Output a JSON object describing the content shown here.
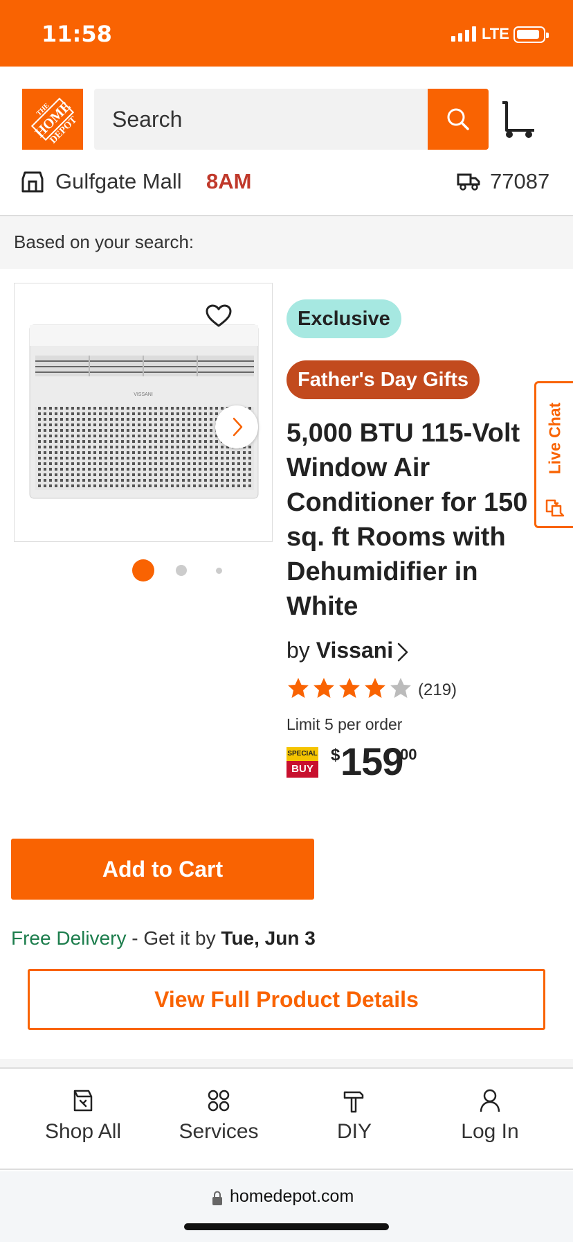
{
  "status_bar": {
    "time": "11:58",
    "network": "LTE"
  },
  "header": {
    "search": {
      "placeholder": "Search"
    },
    "store": {
      "name": "Gulfgate Mall",
      "hours": "8AM"
    },
    "zip": "77087"
  },
  "based_on": "Based on your search:",
  "product": {
    "badges": {
      "exclusive": "Exclusive",
      "promo": "Father's Day Gifts"
    },
    "title": "5,000 BTU 115-Volt Window Air Conditioner for 150 sq. ft Rooms with Dehumidifier in White",
    "brand_prefix": "by",
    "brand": "Vissani",
    "rating": 4,
    "rating_max": 5,
    "review_count": "(219)",
    "limit": "Limit 5 per order",
    "special_buy": {
      "top": "SPECIAL",
      "bottom": "BUY"
    },
    "price": {
      "currency": "$",
      "dollars": "159",
      "cents": "00"
    },
    "image_count": 3,
    "image_active": 1,
    "image_brand_text": "VISSANI"
  },
  "actions": {
    "add_to_cart": "Add to Cart",
    "delivery_free": "Free Delivery",
    "delivery_mid": " - Get it by ",
    "delivery_date": "Tue, Jun 3",
    "view_details": "View Full Product Details"
  },
  "live_chat": "Live Chat",
  "bottom_nav": [
    {
      "label": "Shop All",
      "icon": "shop-all-icon"
    },
    {
      "label": "Services",
      "icon": "services-icon"
    },
    {
      "label": "DIY",
      "icon": "hammer-icon"
    },
    {
      "label": "Log In",
      "icon": "user-icon"
    }
  ],
  "browser": {
    "url": "homedepot.com"
  },
  "colors": {
    "brand_orange": "#f96302",
    "star": "#f96302",
    "star_empty": "#bbbbbb",
    "exclusive_bg": "#a6e8e1",
    "promo_bg": "#c24a1e",
    "free_delivery": "#1c7d4c",
    "store_hours": "#c0392b"
  }
}
